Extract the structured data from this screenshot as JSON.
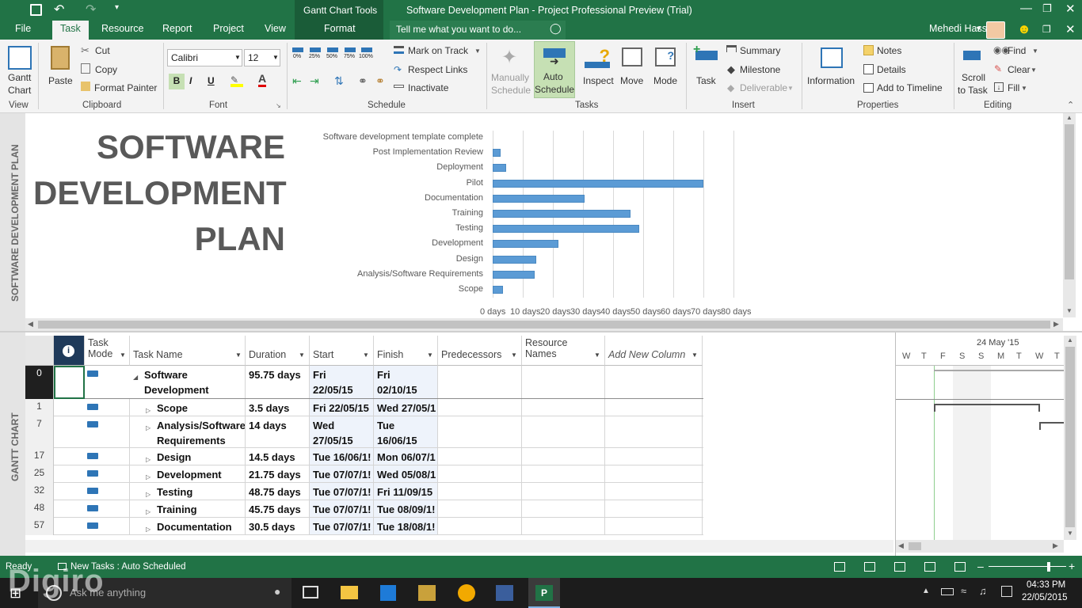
{
  "titlebar": {
    "contextual_tools": "Gantt Chart Tools",
    "window_title": "Software Development Plan - Project Professional Preview (Trial)"
  },
  "tabs": {
    "file": "File",
    "task": "Task",
    "resource": "Resource",
    "report": "Report",
    "project": "Project",
    "view": "View",
    "format": "Format",
    "tell_me_placeholder": "Tell me what you want to do...",
    "user": "Mehedi Hassan"
  },
  "ribbon": {
    "view_group": {
      "label": "View",
      "gantt_chart": [
        "Gantt",
        "Chart"
      ]
    },
    "clipboard": {
      "label": "Clipboard",
      "paste": "Paste",
      "cut": "Cut",
      "copy": "Copy",
      "format_painter": "Format Painter"
    },
    "font": {
      "label": "Font",
      "name": "Calibri",
      "size": "12",
      "bold": "B",
      "italic": "I",
      "underline": "U"
    },
    "schedule": {
      "label": "Schedule",
      "percents": [
        "0%",
        "25%",
        "50%",
        "75%",
        "100%"
      ],
      "mark_on_track": "Mark on Track",
      "respect_links": "Respect Links",
      "inactivate": "Inactivate"
    },
    "tasks": {
      "label": "Tasks",
      "manually": [
        "Manually",
        "Schedule"
      ],
      "auto": [
        "Auto",
        "Schedule"
      ],
      "inspect": "Inspect",
      "move": "Move",
      "mode": "Mode"
    },
    "insert": {
      "label": "Insert",
      "task": "Task",
      "summary": "Summary",
      "milestone": "Milestone",
      "deliverable": "Deliverable"
    },
    "properties": {
      "label": "Properties",
      "information": "Information",
      "notes": "Notes",
      "details": "Details",
      "add_to_timeline": "Add to Timeline"
    },
    "editing": {
      "label": "Editing",
      "scroll": [
        "Scroll",
        "to Task"
      ],
      "find": "Find",
      "clear": "Clear",
      "fill": "Fill"
    }
  },
  "sidebar_labels": {
    "top": "SOFTWARE DEVELOPMENT PLAN",
    "bottom": "GANTT CHART"
  },
  "report": {
    "title_lines": [
      "SOFTWARE",
      "DEVELOPMENT",
      "PLAN"
    ]
  },
  "chart_data": {
    "type": "bar",
    "orientation": "horizontal",
    "categories": [
      "Software development template complete",
      "Post Implementation Review",
      "Deployment",
      "Pilot",
      "Documentation",
      "Training",
      "Testing",
      "Development",
      "Design",
      "Analysis/Software Requirements",
      "Scope"
    ],
    "values": [
      0,
      2.5,
      4.5,
      70,
      30.5,
      45.75,
      48.75,
      21.75,
      14.5,
      14,
      3.5
    ],
    "x_ticks": [
      "0 days",
      "10 days",
      "20 days",
      "30 days",
      "40 days",
      "50 days",
      "60 days",
      "70 days",
      "80 days"
    ],
    "xlim": [
      0,
      80
    ],
    "grid": true,
    "colors": {
      "bar": "#5b9bd5"
    }
  },
  "table": {
    "headers": {
      "mode": [
        "Task",
        "Mode"
      ],
      "name": "Task Name",
      "duration": "Duration",
      "start": "Start",
      "finish": "Finish",
      "predecessors": "Predecessors",
      "resource": [
        "Resource",
        "Names"
      ],
      "add_new": "Add New Column"
    },
    "rows": [
      {
        "id": "0",
        "name": [
          "Software",
          "Development"
        ],
        "duration": "95.75 days",
        "start": [
          "Fri",
          "22/05/15"
        ],
        "finish": [
          "Fri",
          "02/10/15"
        ],
        "summary": true
      },
      {
        "id": "1",
        "name": [
          "Scope"
        ],
        "duration": "3.5 days",
        "start": [
          "Fri 22/05/15"
        ],
        "finish": [
          "Wed 27/05/1"
        ]
      },
      {
        "id": "7",
        "name": [
          "Analysis/Software",
          "Requirements"
        ],
        "duration": "14 days",
        "start": [
          "Wed",
          "27/05/15"
        ],
        "finish": [
          "Tue",
          "16/06/15"
        ]
      },
      {
        "id": "17",
        "name": [
          "Design"
        ],
        "duration": "14.5 days",
        "start": [
          "Tue 16/06/1!"
        ],
        "finish": [
          "Mon 06/07/1"
        ]
      },
      {
        "id": "25",
        "name": [
          "Development"
        ],
        "duration": "21.75 days",
        "start": [
          "Tue 07/07/1!"
        ],
        "finish": [
          "Wed 05/08/1"
        ]
      },
      {
        "id": "32",
        "name": [
          "Testing"
        ],
        "duration": "48.75 days",
        "start": [
          "Tue 07/07/1!"
        ],
        "finish": [
          "Fri 11/09/15"
        ]
      },
      {
        "id": "48",
        "name": [
          "Training"
        ],
        "duration": "45.75 days",
        "start": [
          "Tue 07/07/1!"
        ],
        "finish": [
          "Tue 08/09/1!"
        ]
      },
      {
        "id": "57",
        "name": [
          "Documentation"
        ],
        "duration": "30.5 days",
        "start": [
          "Tue 07/07/1!"
        ],
        "finish": [
          "Tue 18/08/1!"
        ]
      }
    ]
  },
  "gantt": {
    "week_label": "24 May '15",
    "days": [
      "W",
      "T",
      "F",
      "S",
      "S",
      "M",
      "T",
      "W",
      "T"
    ]
  },
  "statusbar": {
    "ready": "Ready",
    "new_tasks": "New Tasks : Auto Scheduled"
  },
  "taskbar": {
    "search": "Ask me anything",
    "time": "04:33 PM",
    "date": "22/05/2015"
  },
  "watermark": "Digiro",
  "colors": {
    "accent": "#217346",
    "bar": "#5b9bd5",
    "taskbar": "#1c1c1c"
  }
}
